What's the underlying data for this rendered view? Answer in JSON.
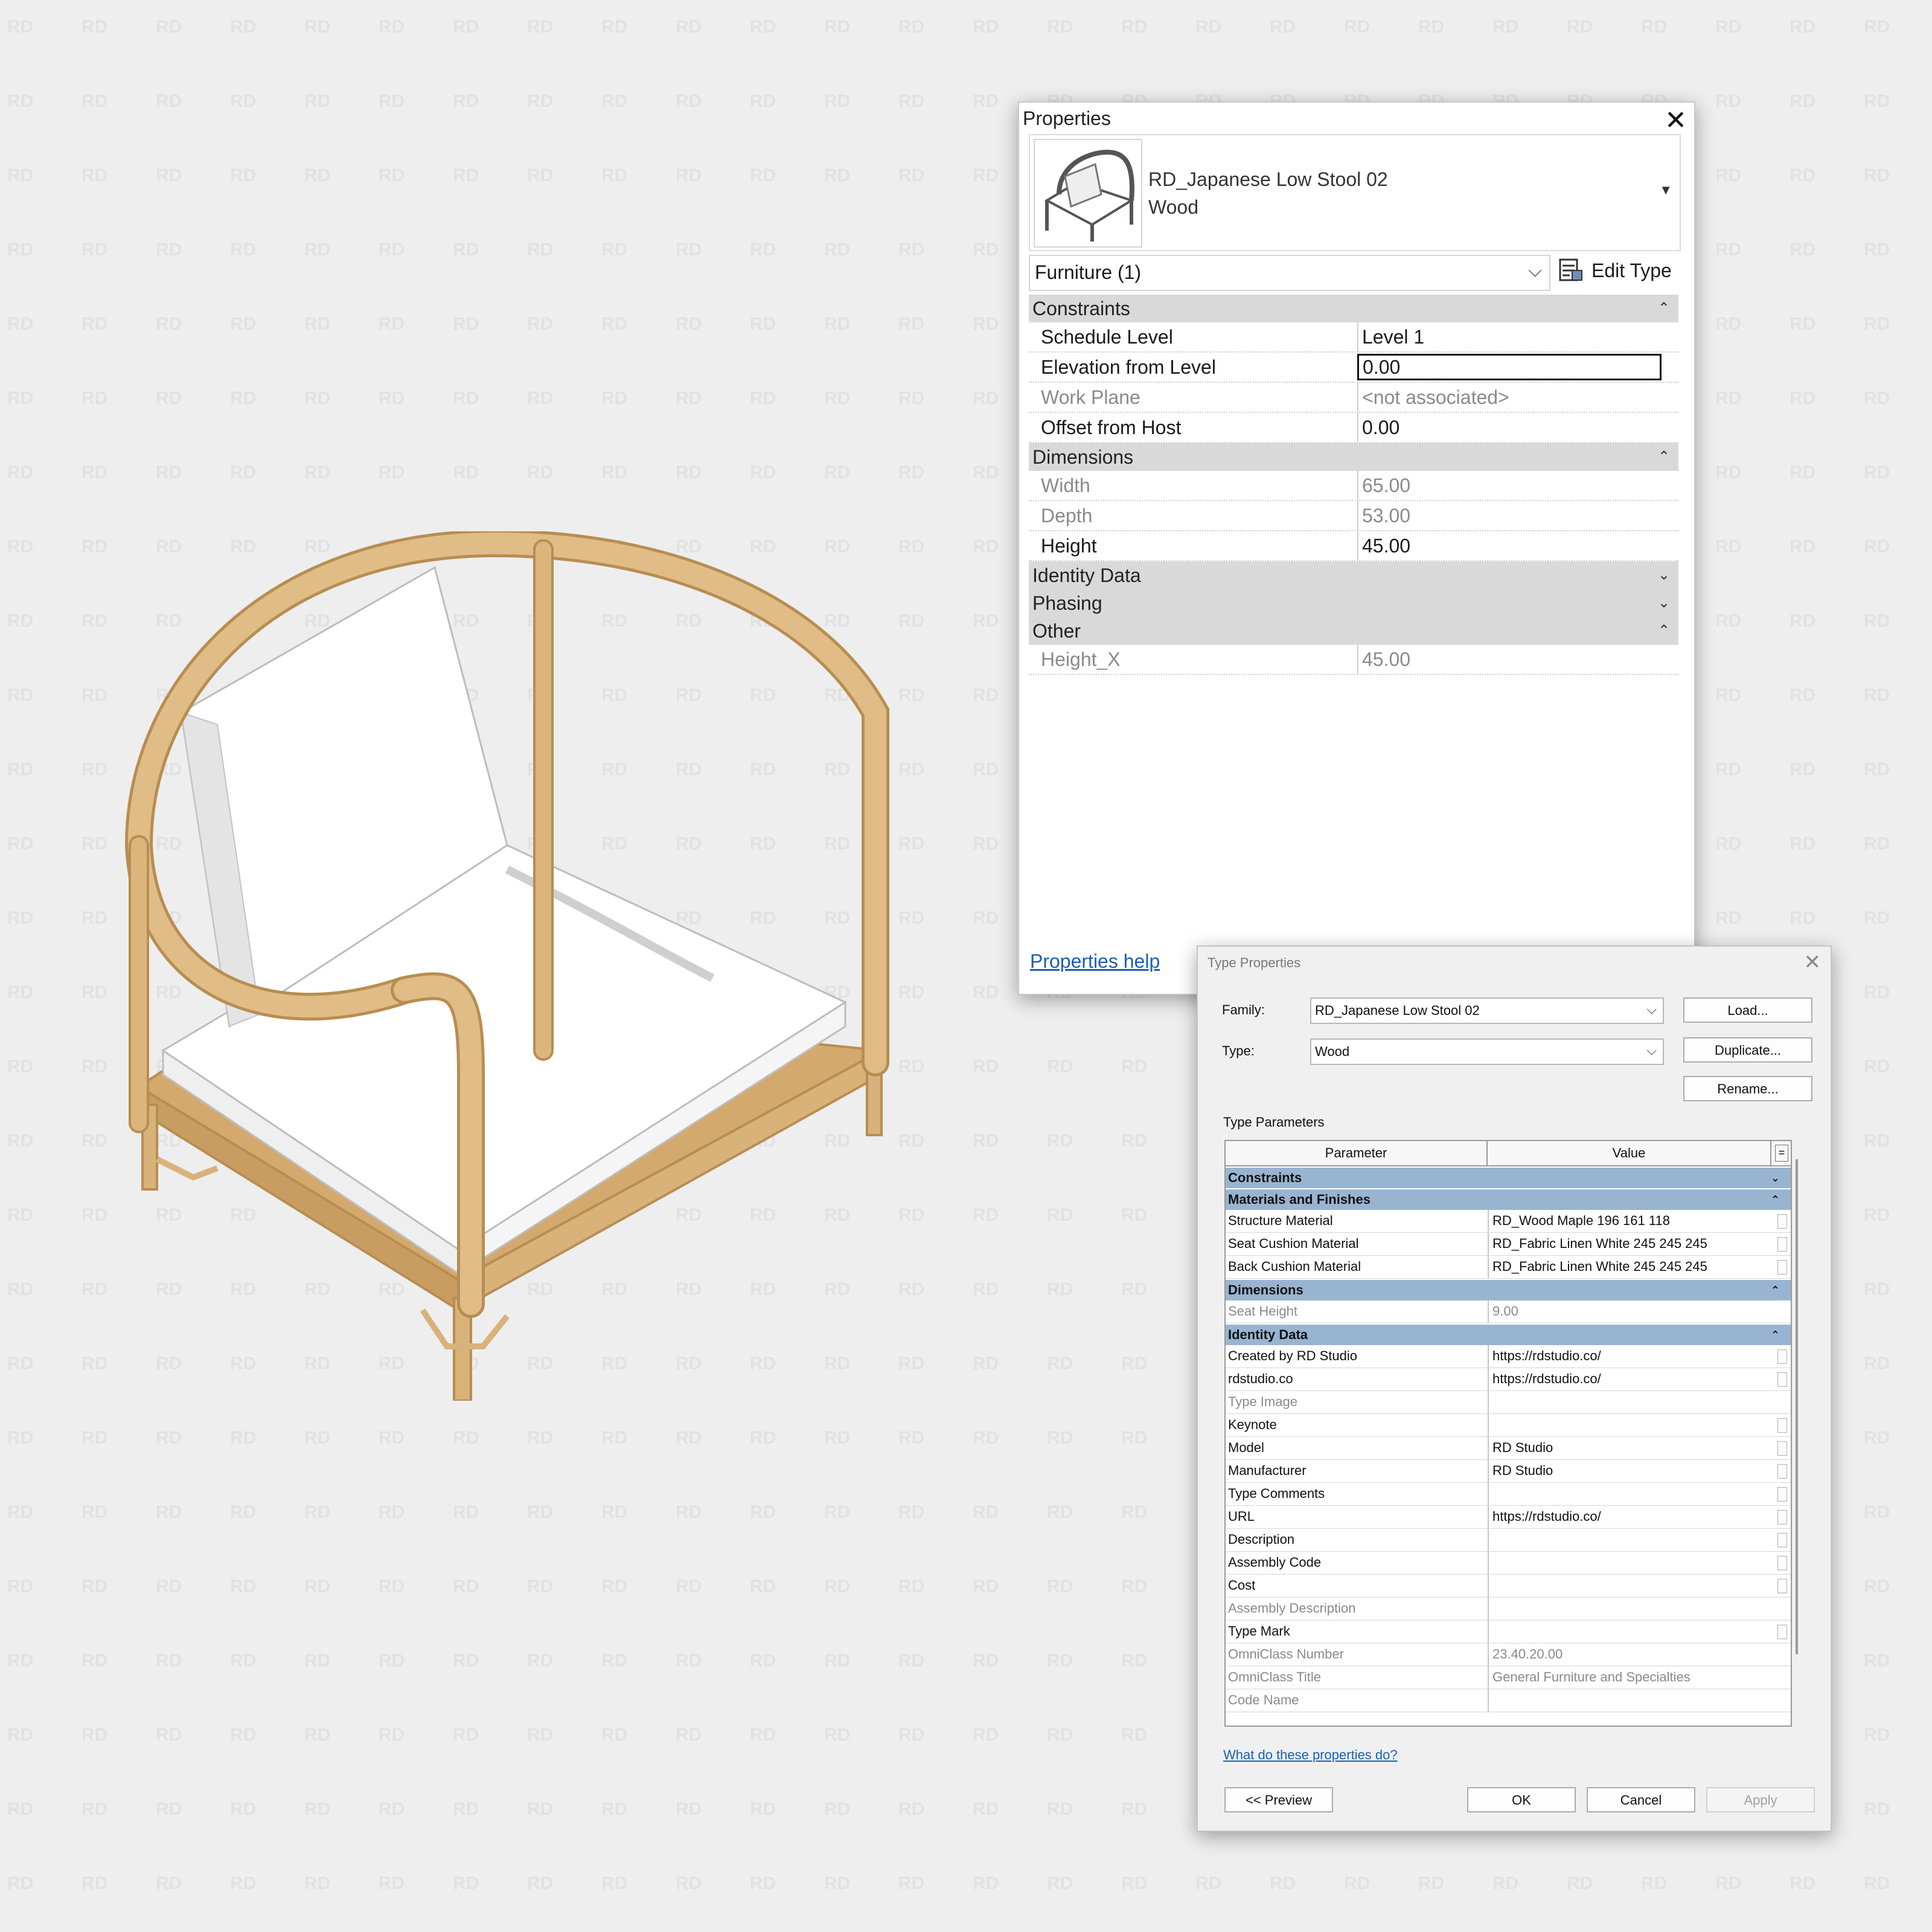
{
  "watermark": "RD",
  "properties": {
    "title": "Properties",
    "type_name": "RD_Japanese Low Stool 02",
    "type_sub": "Wood",
    "selector": "Furniture (1)",
    "edit_type": "Edit Type",
    "help": "Properties help",
    "categories": [
      {
        "name": "Constraints",
        "expanded": true,
        "rows": [
          {
            "key": "Schedule Level",
            "value": "Level 1",
            "grey": false
          },
          {
            "key": "Elevation from Level",
            "value": "0.00",
            "grey": false,
            "editing": true
          },
          {
            "key": "Work Plane",
            "value": "<not associated>",
            "grey": true
          },
          {
            "key": "Offset from Host",
            "value": "0.00",
            "grey": false
          }
        ]
      },
      {
        "name": "Dimensions",
        "expanded": true,
        "rows": [
          {
            "key": "Width",
            "value": "65.00",
            "grey": true
          },
          {
            "key": "Depth",
            "value": "53.00",
            "grey": true
          },
          {
            "key": "Height",
            "value": "45.00",
            "grey": false
          }
        ]
      },
      {
        "name": "Identity Data",
        "expanded": false,
        "rows": []
      },
      {
        "name": "Phasing",
        "expanded": false,
        "rows": []
      },
      {
        "name": "Other",
        "expanded": true,
        "rows": [
          {
            "key": "Height_X",
            "value": "45.00",
            "grey": true
          }
        ]
      }
    ]
  },
  "type_properties": {
    "title": "Type Properties",
    "family_label": "Family:",
    "family_value": "RD_Japanese Low Stool 02",
    "type_label": "Type:",
    "type_value": "Wood",
    "load": "Load...",
    "duplicate": "Duplicate...",
    "rename": "Rename...",
    "params_label": "Type Parameters",
    "col_param": "Parameter",
    "col_value": "Value",
    "col_flag": "=",
    "help_link": "What do these properties do?",
    "preview": "<< Preview",
    "ok": "OK",
    "cancel": "Cancel",
    "apply": "Apply",
    "categories": [
      {
        "name": "Constraints",
        "expanded": false,
        "rows": []
      },
      {
        "name": "Materials and Finishes",
        "expanded": true,
        "rows": [
          {
            "key": "Structure Material",
            "value": "RD_Wood Maple 196 161 118",
            "grey": false
          },
          {
            "key": "Seat Cushion Material",
            "value": "RD_Fabric Linen White 245 245 245",
            "grey": false
          },
          {
            "key": "Back Cushion Material",
            "value": "RD_Fabric Linen White 245 245 245",
            "grey": false
          }
        ]
      },
      {
        "name": "Dimensions",
        "expanded": true,
        "rows": [
          {
            "key": "Seat Height",
            "value": "9.00",
            "grey": true
          }
        ]
      },
      {
        "name": "Identity Data",
        "expanded": true,
        "rows": [
          {
            "key": "Created by RD Studio",
            "value": "https://rdstudio.co/",
            "grey": false
          },
          {
            "key": "rdstudio.co",
            "value": "https://rdstudio.co/",
            "grey": false
          },
          {
            "key": "Type Image",
            "value": "",
            "grey": true
          },
          {
            "key": "Keynote",
            "value": "",
            "grey": false
          },
          {
            "key": "Model",
            "value": "RD Studio",
            "grey": false
          },
          {
            "key": "Manufacturer",
            "value": "RD Studio",
            "grey": false
          },
          {
            "key": "Type Comments",
            "value": "",
            "grey": false
          },
          {
            "key": "URL",
            "value": "https://rdstudio.co/",
            "grey": false
          },
          {
            "key": "Description",
            "value": "",
            "grey": false
          },
          {
            "key": "Assembly Code",
            "value": "",
            "grey": false
          },
          {
            "key": "Cost",
            "value": "",
            "grey": false
          },
          {
            "key": "Assembly Description",
            "value": "",
            "grey": true
          },
          {
            "key": "Type Mark",
            "value": "",
            "grey": false
          },
          {
            "key": "OmniClass Number",
            "value": "23.40.20.00",
            "grey": true
          },
          {
            "key": "OmniClass Title",
            "value": "General Furniture and Specialties",
            "grey": true
          },
          {
            "key": "Code Name",
            "value": "",
            "grey": true
          }
        ]
      }
    ]
  },
  "colors": {
    "background": "#eeeeee",
    "wood": "#d9b27a",
    "category_blue": "#99b4d1",
    "link": "#1a5fb4"
  }
}
